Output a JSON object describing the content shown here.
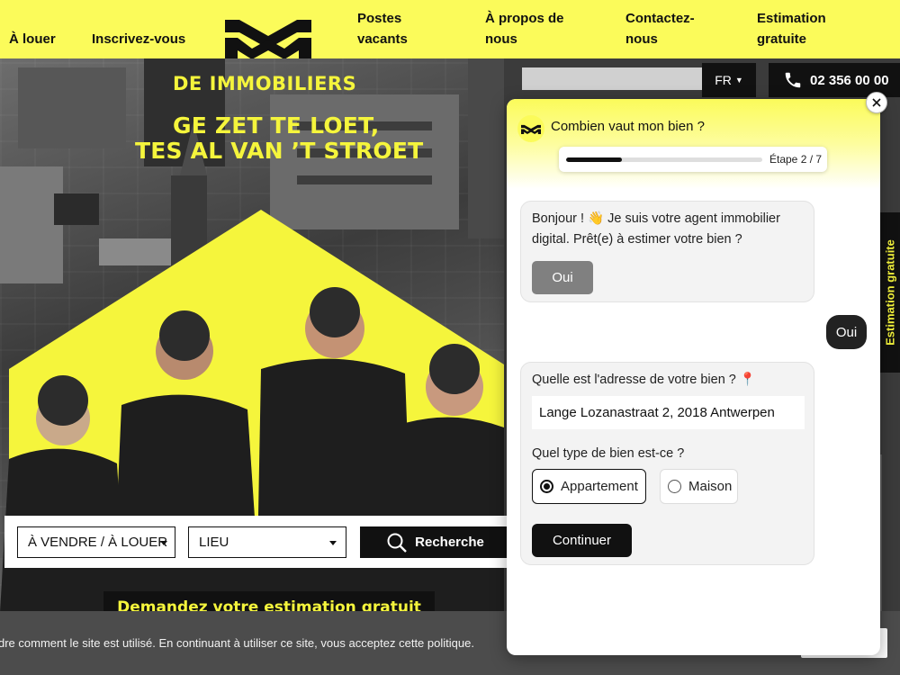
{
  "header": {
    "nav": [
      {
        "label": "À louer"
      },
      {
        "label": "Inscrivez-vous"
      },
      {
        "label_line1": "Postes",
        "label_line2": "vacants"
      },
      {
        "label_line1": "À propos de",
        "label_line2": "nous"
      },
      {
        "label_line1": "Contactez-",
        "label_line2": "nous"
      },
      {
        "label_line1": "Estimation",
        "label_line2": "gratuite"
      }
    ]
  },
  "hero": {
    "tagline": "DE IMMOBILIERS",
    "headline_line1": "GE ZET TE LOET,",
    "headline_line2": "TES AL VAN ’T STROET",
    "language": "FR",
    "phone": "02 356 00 00",
    "side_tab": "Estimation gratuite",
    "estimation_banner": "Demandez votre estimation gratuit"
  },
  "search": {
    "type_select": "À VENDRE / À LOUER",
    "location_select": "LIEU",
    "button": "Recherche"
  },
  "cookie": {
    "text": "dre comment le site est utilisé. En continuant à utiliser ce site, vous acceptez cette politique."
  },
  "chat": {
    "title": "Combien vaut mon bien ?",
    "step_label": "Étape 2 / 7",
    "progress": 0.285,
    "bot_greeting_line1": "Bonjour ! 👋 Je suis votre agent immobilier",
    "bot_greeting_line2": "digital. Prêt(e) à estimer votre bien ?",
    "oui_button": "Oui",
    "user_reply": "Oui",
    "address_question": "Quelle est l'adresse de votre bien ? 📍",
    "address_value": "Lange Lozanastraat 2, 2018 Antwerpen",
    "type_question": "Quel type de bien est-ce ?",
    "options": [
      {
        "label": "Appartement",
        "selected": true
      },
      {
        "label": "Maison",
        "selected": false
      }
    ],
    "continue_button": "Continuer"
  },
  "colors": {
    "brand_yellow": "#fbfb5a",
    "dark": "#111111"
  }
}
